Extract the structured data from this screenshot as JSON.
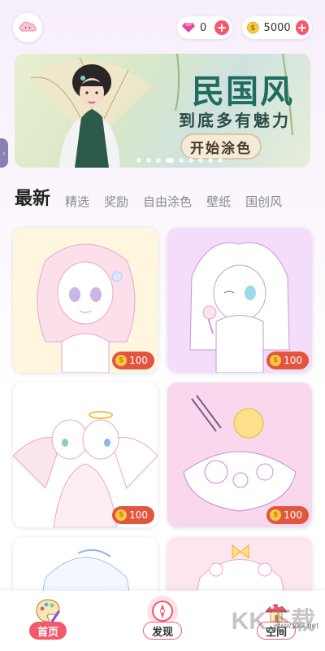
{
  "currency": {
    "gems": "0",
    "coins": "5000",
    "add_label": "+"
  },
  "banner": {
    "title": "民国风",
    "subtitle": "到底多有魅力",
    "button": "开始涂色",
    "side_tab": "›"
  },
  "tabs": [
    "最新",
    "精选",
    "奖励",
    "自由涂色",
    "壁纸",
    "国创风"
  ],
  "cards": [
    {
      "price": "100"
    },
    {
      "price": "100"
    },
    {
      "price": "100"
    },
    {
      "price": "100"
    },
    {
      "price": ""
    },
    {
      "price": ""
    }
  ],
  "coin_symbol": "$",
  "nav": {
    "home": "首页",
    "discover": "发现",
    "space": "空间"
  },
  "watermark": {
    "logo": "KK下载",
    "url": "www.kkx.net"
  },
  "colors": {
    "accent": "#f25a6b",
    "price_badge": "#e2563f",
    "banner_title": "#1f6d60"
  }
}
